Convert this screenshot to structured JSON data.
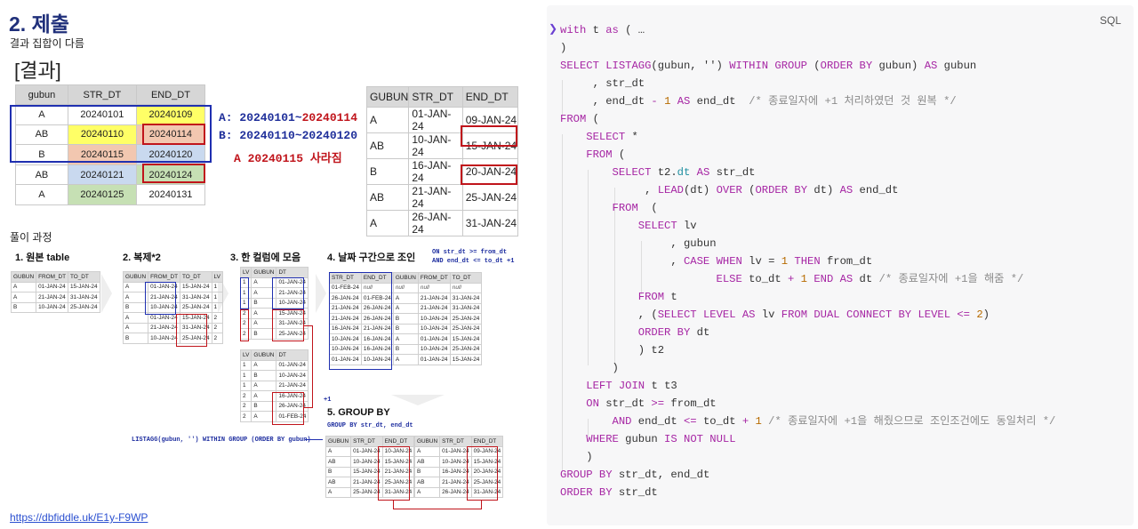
{
  "slide": {
    "title": "2. 제출",
    "subtitle": "결과 집합이 다름",
    "result_label": "[결과]",
    "result_table": {
      "headers": [
        "gubun",
        "STR_DT",
        "END_DT"
      ],
      "rows": [
        [
          "A",
          "20240101",
          "20240109"
        ],
        [
          "AB",
          "20240110",
          "20240114"
        ],
        [
          "B",
          "20240115",
          "20240120"
        ],
        [
          "AB",
          "20240121",
          "20240124"
        ],
        [
          "A",
          "20240125",
          "20240131"
        ]
      ]
    },
    "annotations": {
      "a_prefix": "A: 20240101~",
      "a_suffix": "20240114",
      "b_text": "B: 20240110~20240120",
      "c_text": "A 20240115 사라짐"
    },
    "output_table": {
      "headers": [
        "GUBUN",
        "STR_DT",
        "END_DT"
      ],
      "rows": [
        [
          "A",
          "01-JAN-24",
          "09-JAN-24"
        ],
        [
          "AB",
          "10-JAN-24",
          "15-JAN-24"
        ],
        [
          "B",
          "16-JAN-24",
          "20-JAN-24"
        ],
        [
          "AB",
          "21-JAN-24",
          "25-JAN-24"
        ],
        [
          "A",
          "26-JAN-24",
          "31-JAN-24"
        ]
      ]
    },
    "process_label": "풀이 과정",
    "steps": {
      "s1": "1. 원본 table",
      "s2": "2. 복제*2",
      "s3": "3. 한 컬럼에 모음",
      "s4": "4. 날짜 구간으로 조인",
      "s5": "5. GROUP BY"
    },
    "sql_notes": {
      "join_1": "ON str_dt >= from_dt",
      "join_2": "AND end_dt <= to_dt +1",
      "plus_one": "+1",
      "group_by": "GROUP BY str_dt, end_dt",
      "listagg": "LISTAGG(gubun, '') WITHIN GROUP (ORDER BY gubun)"
    },
    "mini_tables": {
      "t1": {
        "headers": [
          "GUBUN",
          "FROM_DT",
          "TO_DT"
        ],
        "rows": [
          [
            "A",
            "01-JAN-24",
            "15-JAN-24"
          ],
          [
            "A",
            "21-JAN-24",
            "31-JAN-24"
          ],
          [
            "B",
            "10-JAN-24",
            "25-JAN-24"
          ]
        ]
      },
      "t2": {
        "headers": [
          "GUBUN",
          "FROM_DT",
          "TO_DT",
          "LV"
        ],
        "rows": [
          [
            "A",
            "01-JAN-24",
            "15-JAN-24",
            "1"
          ],
          [
            "A",
            "21-JAN-24",
            "31-JAN-24",
            "1"
          ],
          [
            "B",
            "10-JAN-24",
            "25-JAN-24",
            "1"
          ],
          [
            "A",
            "01-JAN-24",
            "15-JAN-24",
            "2"
          ],
          [
            "A",
            "21-JAN-24",
            "31-JAN-24",
            "2"
          ],
          [
            "B",
            "10-JAN-24",
            "25-JAN-24",
            "2"
          ]
        ]
      },
      "t3a": {
        "headers": [
          "LV",
          "GUBUN",
          "DT"
        ],
        "rows": [
          [
            "1",
            "A",
            "01-JAN-24"
          ],
          [
            "1",
            "A",
            "21-JAN-24"
          ],
          [
            "1",
            "B",
            "10-JAN-24"
          ],
          [
            "2",
            "A",
            "15-JAN-24"
          ],
          [
            "2",
            "A",
            "31-JAN-24"
          ],
          [
            "2",
            "B",
            "25-JAN-24"
          ]
        ]
      },
      "t3b": {
        "headers": [],
        "rows": [
          [
            "1",
            "A",
            "01-JAN-24"
          ],
          [
            "1",
            "B",
            "10-JAN-24"
          ],
          [
            "1",
            "A",
            "21-JAN-24"
          ],
          [
            "2",
            "A",
            "16-JAN-24"
          ],
          [
            "2",
            "B",
            "26-JAN-24"
          ],
          [
            "2",
            "A",
            "01-FEB-24"
          ]
        ]
      },
      "t4": {
        "headers": [
          "STR_DT",
          "END_DT",
          "GUBUN",
          "FROM_DT",
          "TO_DT"
        ],
        "rows": [
          [
            "01-FEB-24",
            "null",
            "null",
            "null",
            "null"
          ],
          [
            "26-JAN-24",
            "01-FEB-24",
            "A",
            "21-JAN-24",
            "31-JAN-24"
          ],
          [
            "21-JAN-24",
            "26-JAN-24",
            "A",
            "21-JAN-24",
            "31-JAN-24"
          ],
          [
            "21-JAN-24",
            "26-JAN-24",
            "B",
            "10-JAN-24",
            "25-JAN-24"
          ],
          [
            "16-JAN-24",
            "21-JAN-24",
            "B",
            "10-JAN-24",
            "25-JAN-24"
          ],
          [
            "10-JAN-24",
            "16-JAN-24",
            "A",
            "01-JAN-24",
            "15-JAN-24"
          ],
          [
            "10-JAN-24",
            "16-JAN-24",
            "B",
            "10-JAN-24",
            "25-JAN-24"
          ],
          [
            "01-JAN-24",
            "10-JAN-24",
            "A",
            "01-JAN-24",
            "15-JAN-24"
          ]
        ]
      },
      "t5a": {
        "headers": [
          "GUBUN",
          "STR_DT",
          "END_DT"
        ],
        "rows": [
          [
            "A",
            "01-JAN-24",
            "10-JAN-24"
          ],
          [
            "AB",
            "10-JAN-24",
            "15-JAN-24"
          ],
          [
            "B",
            "15-JAN-24",
            "21-JAN-24"
          ],
          [
            "AB",
            "21-JAN-24",
            "25-JAN-24"
          ],
          [
            "A",
            "25-JAN-24",
            "31-JAN-24"
          ]
        ]
      },
      "t5b": {
        "headers": [
          "GUBUN",
          "STR_DT",
          "END_DT"
        ],
        "rows": [
          [
            "A",
            "01-JAN-24",
            "09-JAN-24"
          ],
          [
            "AB",
            "10-JAN-24",
            "15-JAN-24"
          ],
          [
            "B",
            "16-JAN-24",
            "20-JAN-24"
          ],
          [
            "AB",
            "21-JAN-24",
            "25-JAN-24"
          ],
          [
            "A",
            "26-JAN-24",
            "31-JAN-24"
          ]
        ]
      }
    },
    "link_text": "https://dbfiddle.uk/E1y-F9WP"
  },
  "code": {
    "language": "SQL",
    "lines": [
      "with t as ( …",
      ")",
      "SELECT LISTAGG(gubun, '') WITHIN GROUP (ORDER BY gubun) AS gubun",
      "     , str_dt",
      "     , end_dt - 1 AS end_dt  /* 종료일자에 +1 처리하였던 것 원복 */",
      "FROM (",
      "    SELECT *",
      "    FROM (",
      "        SELECT t2.dt AS str_dt",
      "             , LEAD(dt) OVER (ORDER BY dt) AS end_dt",
      "        FROM  (",
      "            SELECT lv",
      "                 , gubun",
      "                 , CASE WHEN lv = 1 THEN from_dt",
      "                        ELSE to_dt + 1 END AS dt /* 종료일자에 +1을 해줌 */",
      "            FROM t",
      "            , (SELECT LEVEL AS lv FROM DUAL CONNECT BY LEVEL <= 2)",
      "            ORDER BY dt",
      "            ) t2",
      "        )",
      "    LEFT JOIN t t3",
      "    ON str_dt >= from_dt",
      "        AND end_dt <= to_dt + 1 /* 종료일자에 +1을 해줬으므로 조인조건에도 동일처리 */",
      "    WHERE gubun IS NOT NULL",
      "    )",
      "GROUP BY str_dt, end_dt",
      "ORDER BY str_dt"
    ]
  },
  "colors": {
    "title": "#1f2f7a",
    "highlight_blue_box": "#1f2fb0",
    "highlight_red_box": "#c0141b",
    "keyword": "#a626a4",
    "number": "#b76b01",
    "comment": "#8c8c8c"
  },
  "icons": {
    "fold": "chevron-right-icon"
  }
}
